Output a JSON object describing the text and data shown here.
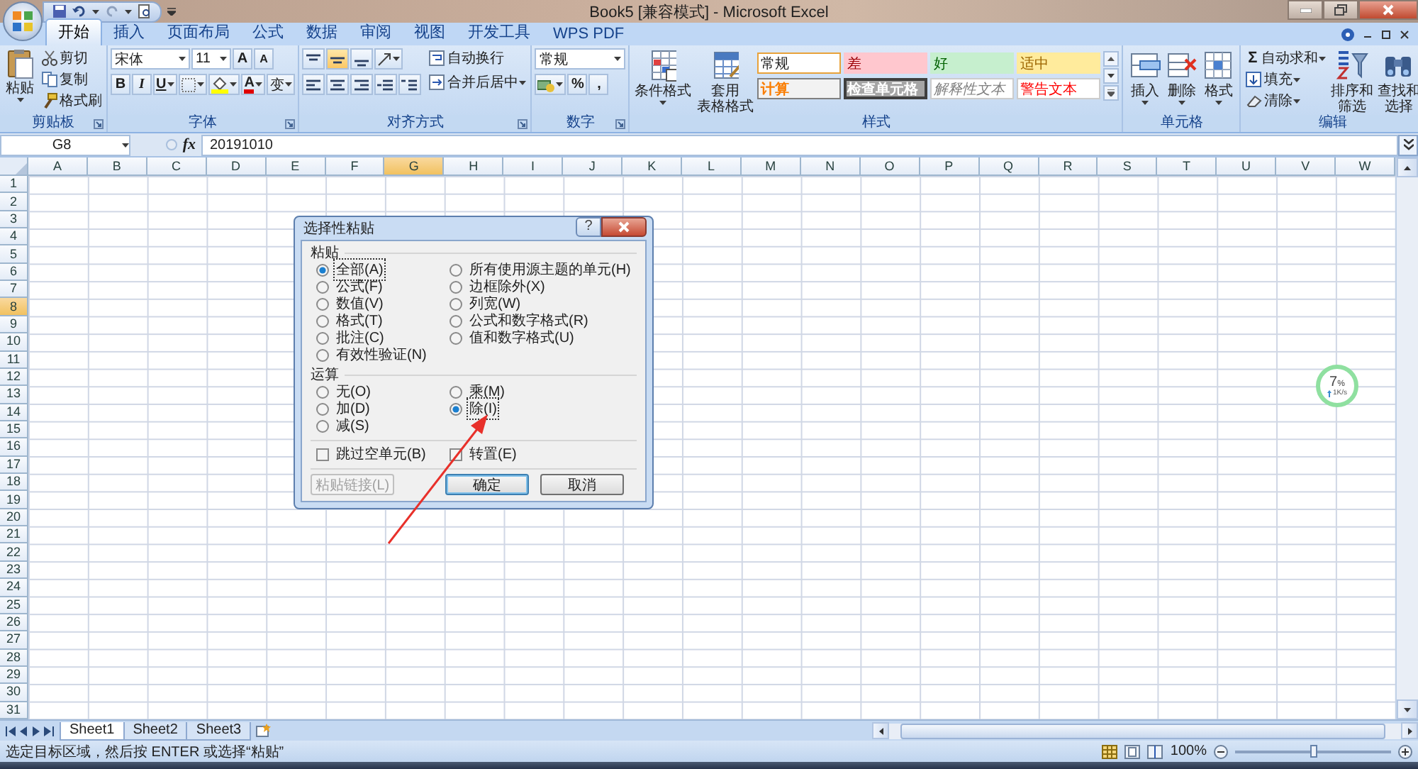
{
  "window": {
    "title": "Book5  [兼容模式] - Microsoft Excel"
  },
  "ribbon_tabs": [
    {
      "label": "开始",
      "selected": true
    },
    {
      "label": "插入",
      "selected": false
    },
    {
      "label": "页面布局",
      "selected": false
    },
    {
      "label": "公式",
      "selected": false
    },
    {
      "label": "数据",
      "selected": false
    },
    {
      "label": "审阅",
      "selected": false
    },
    {
      "label": "视图",
      "selected": false
    },
    {
      "label": "开发工具",
      "selected": false
    },
    {
      "label": "WPS PDF",
      "selected": false
    }
  ],
  "clipboard": {
    "label": "剪贴板",
    "paste": "粘贴",
    "items": [
      {
        "kind": "cut",
        "label": "剪切"
      },
      {
        "kind": "copy",
        "label": "复制"
      },
      {
        "kind": "painter",
        "label": "格式刷"
      }
    ]
  },
  "font": {
    "label": "字体",
    "name": "宋体",
    "size": "11",
    "grow": "A",
    "shrink": "A",
    "bold": "B",
    "italic": "I",
    "underline": "U",
    "fg_letter": "A",
    "phonetic": "变"
  },
  "alignment": {
    "label": "对齐方式",
    "wrap": "自动换行",
    "merge": "合并后居中"
  },
  "number": {
    "label": "数字",
    "format": "常规",
    "percent": "%",
    "comma": ","
  },
  "styles": {
    "label": "样式",
    "conditional": "条件格式",
    "table": [
      "套用",
      "表格格式"
    ],
    "cells": [
      {
        "label": "常规",
        "kind": "normal"
      },
      {
        "label": "差",
        "kind": "bad"
      },
      {
        "label": "好",
        "kind": "good"
      },
      {
        "label": "适中",
        "kind": "neutral"
      },
      {
        "label": "计算",
        "kind": "calculation"
      },
      {
        "label": "检查单元格",
        "kind": "check"
      },
      {
        "label": "解释性文本",
        "kind": "explanatory"
      },
      {
        "label": "警告文本",
        "kind": "warning"
      }
    ]
  },
  "cells": {
    "label": "单元格",
    "buttons": [
      {
        "kind": "insert",
        "label": "插入"
      },
      {
        "kind": "delete",
        "label": "删除"
      },
      {
        "kind": "format",
        "label": "格式"
      }
    ]
  },
  "editing": {
    "label": "编辑",
    "sum_symbol": "Σ",
    "items": [
      {
        "kind": "sum",
        "label": "自动求和"
      },
      {
        "kind": "fill",
        "label": "填充"
      },
      {
        "kind": "clear",
        "label": "清除"
      }
    ],
    "buttons": [
      {
        "kind": "sort",
        "label": [
          "排序和",
          "筛选"
        ]
      },
      {
        "kind": "find",
        "label": [
          "查找和",
          "选择"
        ]
      }
    ]
  },
  "formula_bar": {
    "name_box": "G8",
    "fx": "fx",
    "value": "20191010"
  },
  "sheet": {
    "columns": [
      {
        "label": "A",
        "selected": false
      },
      {
        "label": "B",
        "selected": false
      },
      {
        "label": "C",
        "selected": false
      },
      {
        "label": "D",
        "selected": false
      },
      {
        "label": "E",
        "selected": false
      },
      {
        "label": "F",
        "selected": false
      },
      {
        "label": "G",
        "selected": true
      },
      {
        "label": "H",
        "selected": false
      },
      {
        "label": "I",
        "selected": false
      },
      {
        "label": "J",
        "selected": false
      },
      {
        "label": "K",
        "selected": false
      },
      {
        "label": "L",
        "selected": false
      },
      {
        "label": "M",
        "selected": false
      },
      {
        "label": "N",
        "selected": false
      },
      {
        "label": "O",
        "selected": false
      },
      {
        "label": "P",
        "selected": false
      },
      {
        "label": "Q",
        "selected": false
      },
      {
        "label": "R",
        "selected": false
      },
      {
        "label": "S",
        "selected": false
      },
      {
        "label": "T",
        "selected": false
      },
      {
        "label": "U",
        "selected": false
      },
      {
        "label": "V",
        "selected": false
      },
      {
        "label": "W",
        "selected": false
      }
    ],
    "rows": [
      {
        "label": "1",
        "selected": false
      },
      {
        "label": "2",
        "selected": false
      },
      {
        "label": "3",
        "selected": false
      },
      {
        "label": "4",
        "selected": false
      },
      {
        "label": "5",
        "selected": false
      },
      {
        "label": "6",
        "selected": false
      },
      {
        "label": "7",
        "selected": false
      },
      {
        "label": "8",
        "selected": true
      },
      {
        "label": "9",
        "selected": false
      },
      {
        "label": "10",
        "selected": false
      },
      {
        "label": "11",
        "selected": false
      },
      {
        "label": "12",
        "selected": false
      },
      {
        "label": "13",
        "selected": false
      },
      {
        "label": "14",
        "selected": false
      },
      {
        "label": "15",
        "selected": false
      },
      {
        "label": "16",
        "selected": false
      },
      {
        "label": "17",
        "selected": false
      },
      {
        "label": "18",
        "selected": false
      },
      {
        "label": "19",
        "selected": false
      },
      {
        "label": "20",
        "selected": false
      },
      {
        "label": "21",
        "selected": false
      },
      {
        "label": "22",
        "selected": false
      },
      {
        "label": "23",
        "selected": false
      },
      {
        "label": "24",
        "selected": false
      },
      {
        "label": "25",
        "selected": false
      },
      {
        "label": "26",
        "selected": false
      },
      {
        "label": "27",
        "selected": false
      },
      {
        "label": "28",
        "selected": false
      },
      {
        "label": "29",
        "selected": false
      },
      {
        "label": "30",
        "selected": false
      },
      {
        "label": "31",
        "selected": false
      }
    ]
  },
  "dialog": {
    "title": "选择性粘贴",
    "help": "?",
    "paste": {
      "label": "粘贴",
      "left": [
        {
          "label": "全部(A)",
          "selected": true
        },
        {
          "label": "公式(F)",
          "selected": false
        },
        {
          "label": "数值(V)",
          "selected": false
        },
        {
          "label": "格式(T)",
          "selected": false
        },
        {
          "label": "批注(C)",
          "selected": false
        },
        {
          "label": "有效性验证(N)",
          "selected": false
        }
      ],
      "right": [
        {
          "label": "所有使用源主题的单元(H)",
          "selected": false
        },
        {
          "label": "边框除外(X)",
          "selected": false
        },
        {
          "label": "列宽(W)",
          "selected": false
        },
        {
          "label": "公式和数字格式(R)",
          "selected": false
        },
        {
          "label": "值和数字格式(U)",
          "selected": false
        }
      ]
    },
    "operation": {
      "label": "运算",
      "left": [
        {
          "label": "无(O)",
          "selected": false
        },
        {
          "label": "加(D)",
          "selected": false
        },
        {
          "label": "减(S)",
          "selected": false
        }
      ],
      "right": [
        {
          "label": "乘(M)",
          "selected": false
        },
        {
          "label": "除(I)",
          "selected": true
        }
      ]
    },
    "checkboxes": [
      {
        "label": "跳过空单元(B)",
        "checked": false
      },
      {
        "label": "转置(E)",
        "checked": false
      }
    ],
    "buttons": [
      {
        "label": "粘贴链接(L)",
        "disabled": true
      },
      {
        "label": "确定",
        "disabled": false
      },
      {
        "label": "取消",
        "disabled": false
      }
    ]
  },
  "sheet_tabs": [
    {
      "label": "Sheet1",
      "selected": true
    },
    {
      "label": "Sheet2",
      "selected": false
    },
    {
      "label": "Sheet3",
      "selected": false
    }
  ],
  "status_bar": {
    "message": "选定目标区域，然后按 ENTER 或选择“粘贴”",
    "zoom": "100%",
    "zoom_slider": {
      "level": 0.5
    }
  },
  "speed_widget": {
    "value": "7",
    "unit": "%",
    "rate": "1K/s"
  }
}
